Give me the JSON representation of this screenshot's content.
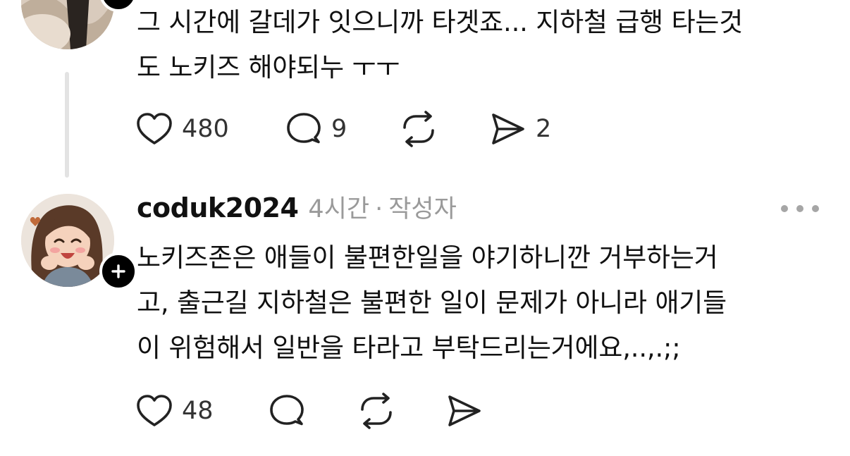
{
  "comments": [
    {
      "text_lines": [
        "그 시간에 갈데가 잇으니까 타겟죠... 지하철 급행 타는것",
        "도 노키즈 해야되누 ㅜㅜ"
      ],
      "actions": {
        "likes": "480",
        "replies": "9",
        "reposts": "",
        "shares": "2"
      }
    },
    {
      "username": "coduk2024",
      "time": "4시간",
      "separator": "·",
      "author_tag": "작성자",
      "text_lines": [
        "노키즈존은 애들이 불편한일을 야기하니깐 거부하는거",
        "고, 출근길 지하철은 불편한 일이 문제가 아니라 애기들",
        "이 위험해서 일반을 타라고 부탁드리는거에요,..,.;;"
      ],
      "actions": {
        "likes": "48",
        "replies": "",
        "reposts": "",
        "shares": ""
      }
    }
  ],
  "icons": {
    "like": "heart-icon",
    "reply": "speech-bubble-icon",
    "repost": "repost-icon",
    "share": "send-icon",
    "follow": "plus-icon",
    "more": "more-horizontal-icon"
  },
  "colors": {
    "text": "#111111",
    "muted": "#9a9a9a",
    "icon": "#222222",
    "thread_line": "#e3e3e3",
    "badge": "#000000"
  }
}
